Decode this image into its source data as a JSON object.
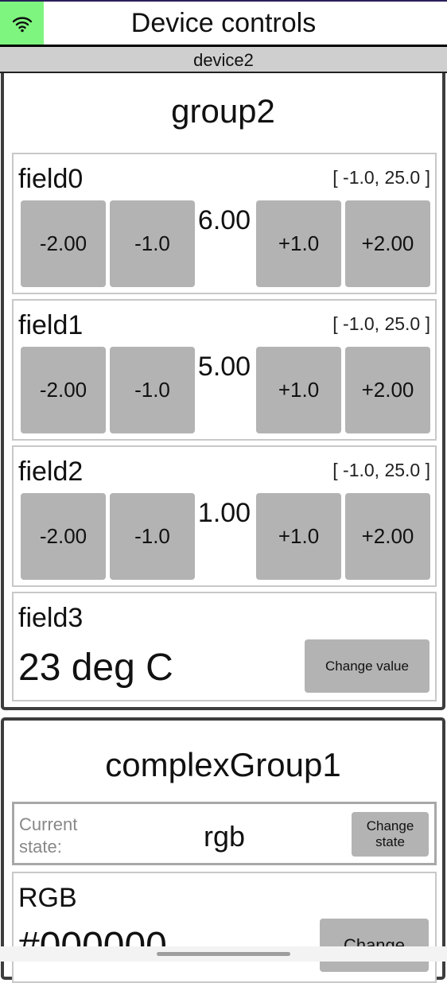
{
  "header": {
    "title": "Device controls",
    "wifi_icon": "wifi-icon",
    "wifi_color": "#7ef57e"
  },
  "device": {
    "name": "device2"
  },
  "group2": {
    "title": "group2",
    "fields": [
      {
        "name": "field0",
        "range": "[ -1.0, 25.0 ]",
        "value": "6.00",
        "buttons": [
          "-2.00",
          "-1.0",
          "+1.0",
          "+2.00"
        ]
      },
      {
        "name": "field1",
        "range": "[ -1.0, 25.0 ]",
        "value": "5.00",
        "buttons": [
          "-2.00",
          "-1.0",
          "+1.0",
          "+2.00"
        ]
      },
      {
        "name": "field2",
        "range": "[ -1.0, 25.0 ]",
        "value": "1.00",
        "buttons": [
          "-2.00",
          "-1.0",
          "+1.0",
          "+2.00"
        ]
      }
    ],
    "field3": {
      "name": "field3",
      "value": "23 deg C",
      "button": "Change value"
    }
  },
  "complexGroup1": {
    "title": "complexGroup1",
    "state": {
      "label": "Current state:",
      "value": "rgb",
      "button": "Change state"
    },
    "rgb": {
      "name": "RGB",
      "value": "#000000",
      "button": "Change"
    }
  }
}
